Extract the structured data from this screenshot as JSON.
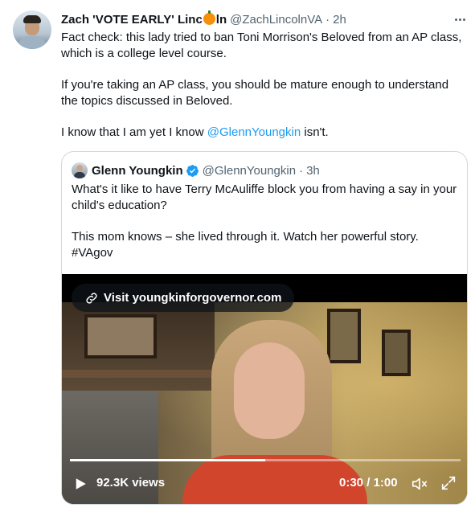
{
  "tweet": {
    "display_name": "Zach 'VOTE EARLY' Linc",
    "display_name_suffix": "ln",
    "handle": "@ZachLincolnVA",
    "separator": "·",
    "time": "2h",
    "more_icon": "more-horizontal-icon",
    "paragraphs": [
      "Fact check: this lady tried to ban Toni Morrison's Beloved from an AP class, which is a college level course.",
      "If you're taking an AP class, you should be mature enough to understand the topics discussed in Beloved."
    ],
    "last_line": {
      "before": "I know that I am yet I know ",
      "mention": "@GlennYoungkin",
      "after": " isn't."
    }
  },
  "quote": {
    "display_name": "Glenn Youngkin",
    "verified_icon": "verified-badge-icon",
    "handle": "@GlennYoungkin",
    "separator": "·",
    "time": "3h",
    "paragraphs": [
      "What's it like to have Terry McAuliffe block you from having a say in your child's education?",
      "This mom knows – she lived through it. Watch her powerful story. #VAgov"
    ],
    "video": {
      "link_label": "Visit youngkinforgovernor.com",
      "views": "92.3K views",
      "time_display": "0:30 / 1:00",
      "progress_fraction": 0.5
    }
  },
  "colors": {
    "accent": "#1d9bf0",
    "text": "#0f1419",
    "muted": "#536471",
    "border": "#cfd9de"
  }
}
